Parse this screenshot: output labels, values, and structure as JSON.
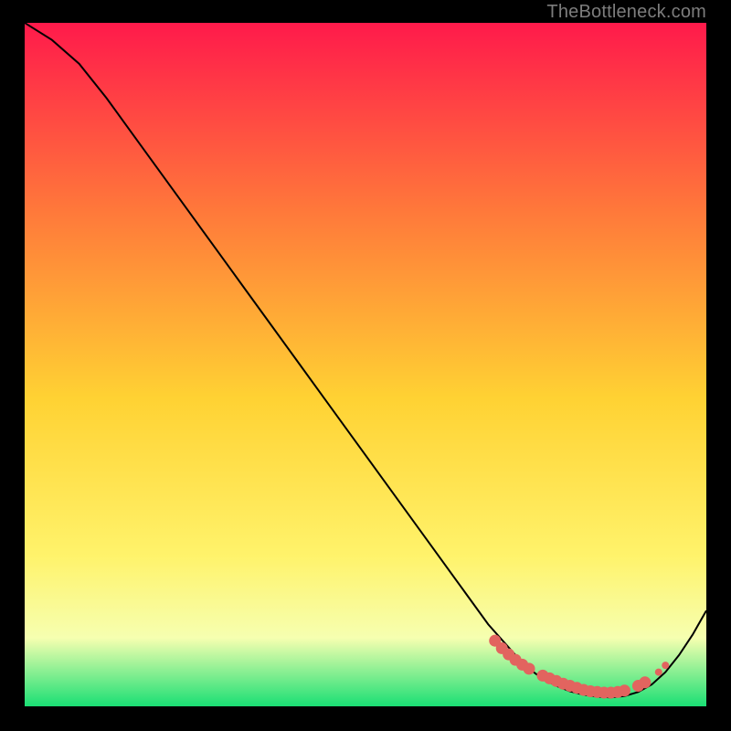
{
  "attribution": "TheBottleneck.com",
  "colors": {
    "bg": "#000000",
    "grad_top": "#ff1a4b",
    "grad_mid_upper": "#ff7a3a",
    "grad_mid": "#ffd233",
    "grad_mid_lower": "#fff36b",
    "grad_lower": "#f6ffb0",
    "grad_bottom": "#1adf74",
    "curve": "#000000",
    "dots": "#e2645f"
  },
  "chart_data": {
    "type": "line",
    "title": "",
    "xlabel": "",
    "ylabel": "",
    "xlim": [
      0,
      100
    ],
    "ylim": [
      0,
      100
    ],
    "x": [
      0,
      4,
      8,
      12,
      16,
      20,
      24,
      28,
      32,
      36,
      40,
      44,
      48,
      52,
      56,
      60,
      64,
      68,
      72,
      74,
      76,
      78,
      80,
      82,
      84,
      86,
      88,
      90,
      92,
      94,
      96,
      98,
      100
    ],
    "y": [
      100,
      97.5,
      94,
      89,
      83.5,
      78,
      72.5,
      67,
      61.5,
      56,
      50.5,
      45,
      39.5,
      34,
      28.5,
      23,
      17.5,
      12,
      7.5,
      5.5,
      4,
      3,
      2.2,
      1.7,
      1.4,
      1.3,
      1.5,
      2.1,
      3.2,
      5,
      7.5,
      10.5,
      14
    ],
    "dots_x": [
      69,
      70,
      71,
      72,
      73,
      74,
      76,
      77,
      78,
      79,
      80,
      81,
      82,
      83,
      84,
      85,
      86,
      87,
      88,
      90,
      91,
      93,
      94
    ],
    "dots_y": [
      9.6,
      8.5,
      7.6,
      6.8,
      6.1,
      5.5,
      4.5,
      4.1,
      3.7,
      3.3,
      3.0,
      2.7,
      2.4,
      2.2,
      2.1,
      2.0,
      2.0,
      2.1,
      2.3,
      3.0,
      3.5,
      5.0,
      6.0
    ],
    "dot_radius_primary": 6.5,
    "dot_radius_secondary": 4.0
  }
}
